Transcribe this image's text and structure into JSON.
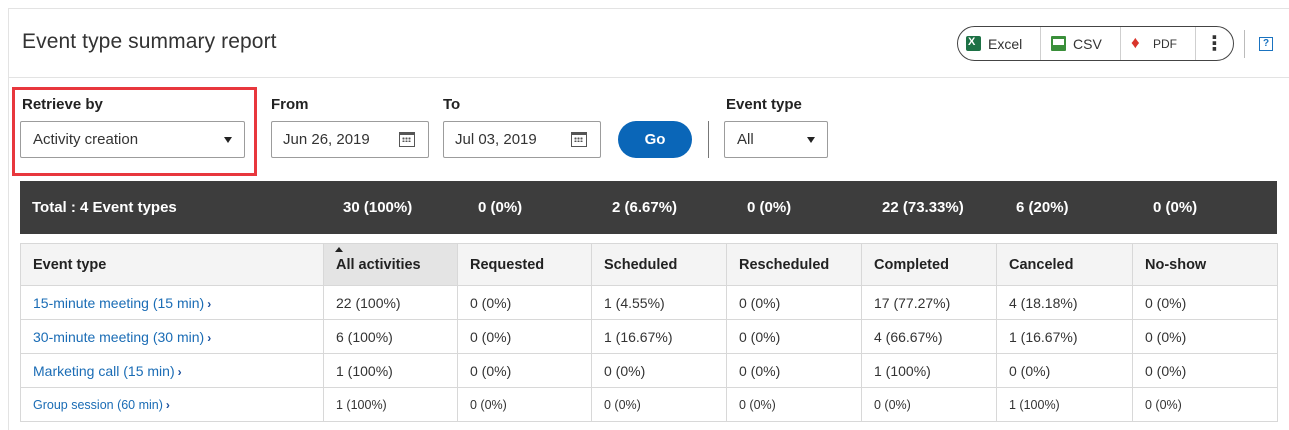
{
  "report": {
    "title": "Event type summary report"
  },
  "exports": {
    "excel": "Excel",
    "csv": "CSV",
    "pdf": "PDF",
    "more": "⋮"
  },
  "help": {
    "label": "?"
  },
  "filters": {
    "retrieve_by": {
      "label": "Retrieve by",
      "value": "Activity creation"
    },
    "from": {
      "label": "From",
      "value": "Jun 26, 2019"
    },
    "to": {
      "label": "To",
      "value": "Jul 03, 2019"
    },
    "go": "Go",
    "event_type": {
      "label": "Event type",
      "value": "All"
    }
  },
  "totals": {
    "label": "Total : 4 Event types",
    "values": [
      "30 (100%)",
      "0 (0%)",
      "2 (6.67%)",
      "0 (0%)",
      "22 (73.33%)",
      "6 (20%)",
      "0 (0%)"
    ]
  },
  "table": {
    "columns": [
      "Event type",
      "All activities",
      "Requested",
      "Scheduled",
      "Rescheduled",
      "Completed",
      "Canceled",
      "No-show"
    ],
    "rows": [
      {
        "name": "15-minute meeting (15 min)",
        "cells": [
          "22 (100%)",
          "0 (0%)",
          "1 (4.55%)",
          "0 (0%)",
          "17 (77.27%)",
          "4 (18.18%)",
          "0 (0%)"
        ]
      },
      {
        "name": "30-minute meeting (30 min)",
        "cells": [
          "6 (100%)",
          "0 (0%)",
          "1 (16.67%)",
          "0 (0%)",
          "4 (66.67%)",
          "1 (16.67%)",
          "0 (0%)"
        ]
      },
      {
        "name": "Marketing call (15 min)",
        "cells": [
          "1 (100%)",
          "0 (0%)",
          "0 (0%)",
          "0 (0%)",
          "1 (100%)",
          "0 (0%)",
          "0 (0%)"
        ]
      },
      {
        "name": "Group session (60 min)",
        "cells": [
          "1 (100%)",
          "0 (0%)",
          "0 (0%)",
          "0 (0%)",
          "0 (0%)",
          "1 (100%)",
          "0 (0%)"
        ]
      }
    ],
    "chevron": "›"
  }
}
